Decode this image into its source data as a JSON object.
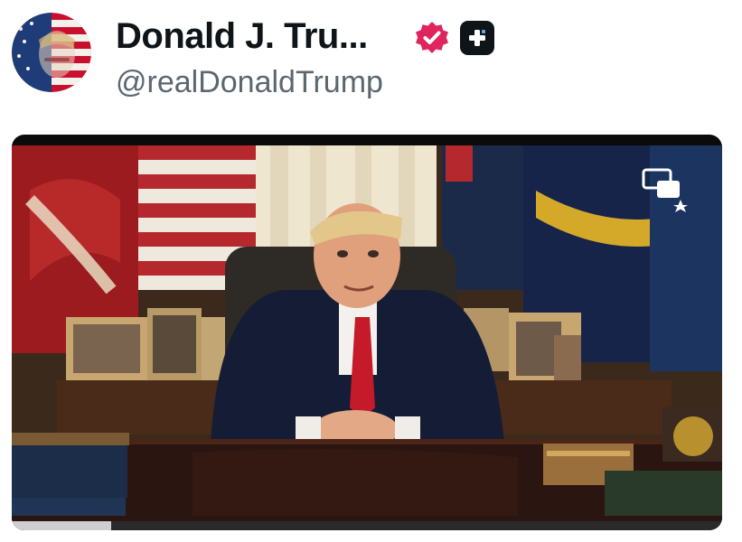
{
  "profile": {
    "display_name": "Donald J. Tru...",
    "handle": "@realDonaldTrump",
    "avatar_icon": "flag-portrait-avatar",
    "verified_icon": "verified-badge-icon",
    "verified_color": "#e0245e",
    "plus_icon": "plus-icon"
  },
  "video": {
    "pip_icon": "picture-in-picture-icon",
    "progress": 0.14,
    "progress_color": "#cfcfcf",
    "track_color": "#2a2a2a"
  }
}
